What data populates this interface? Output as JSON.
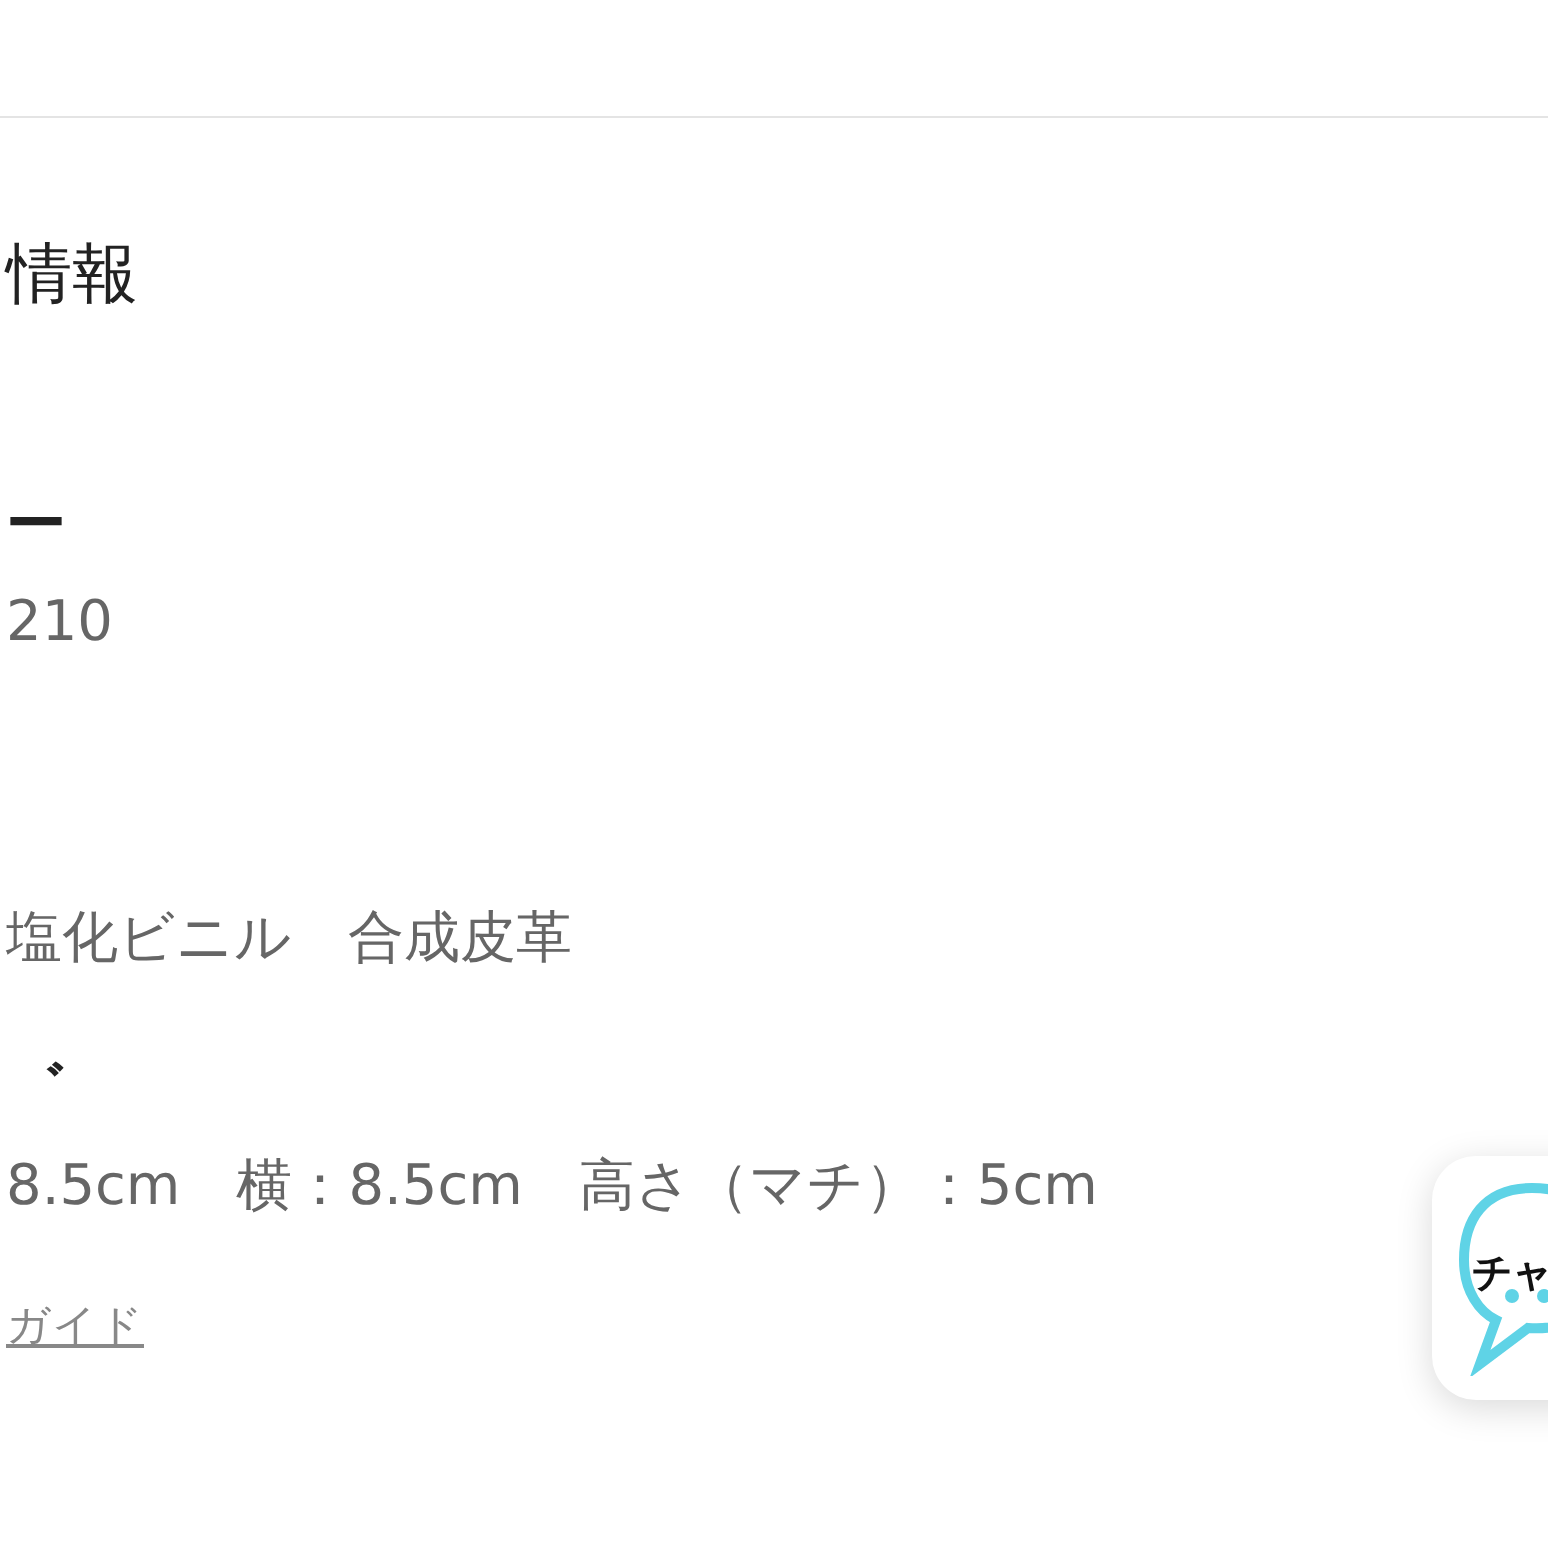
{
  "section_title": "情報",
  "fields": [
    {
      "label": "ー",
      "value": "210"
    },
    {
      "value": "塩化ビニル　合成皮革"
    },
    {
      "label": "゛",
      "value": "8.5cm　横：8.5cm　高さ（マチ）：5cm"
    }
  ],
  "guide_link": "ガイド",
  "chat_button": {
    "label": "チャ"
  }
}
